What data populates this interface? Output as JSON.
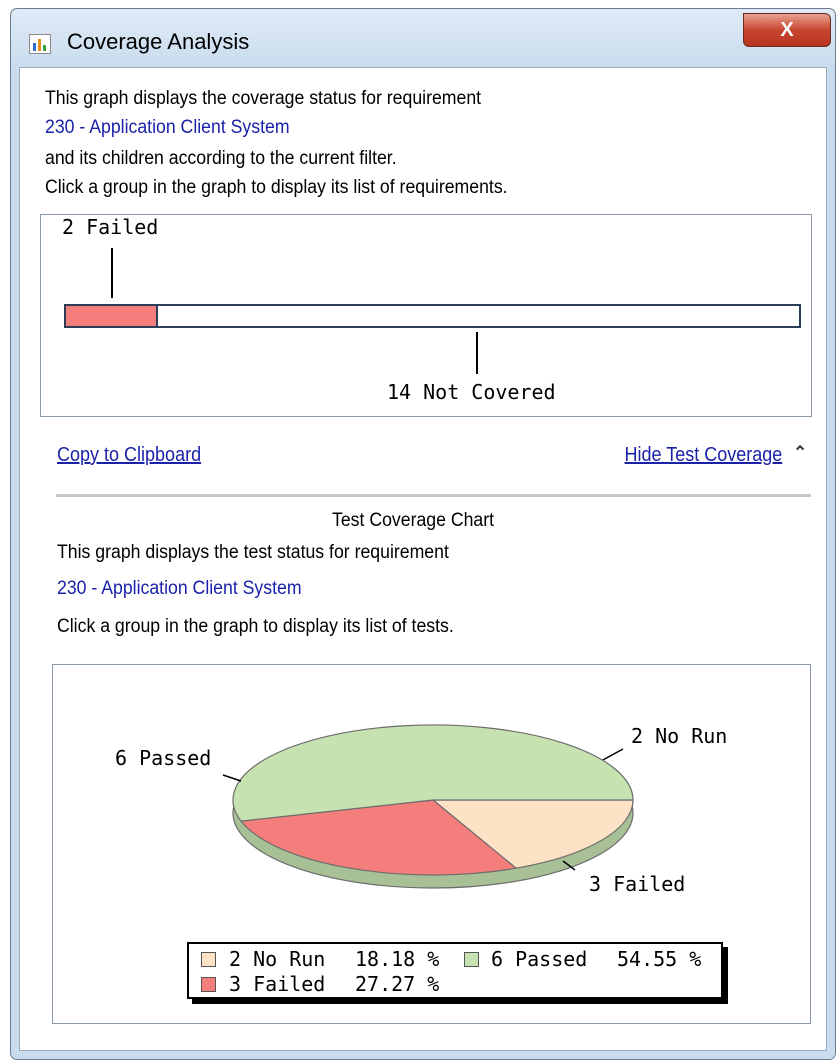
{
  "window": {
    "title": "Coverage Analysis",
    "close_glyph": "X"
  },
  "coverage": {
    "intro_line1": "This graph displays the coverage status for requirement",
    "requirement_link": "230 - Application Client System",
    "intro_line3": "and its children according to the current filter.",
    "intro_line4": "Click a group in the graph to display its list of requirements.",
    "bar": {
      "failed_label": "2 Failed",
      "not_covered_label": "14 Not Covered",
      "failed_count": 2,
      "not_covered_count": 14,
      "failed_color": "#f47e7b"
    }
  },
  "actions": {
    "copy_label": "Copy to Clipboard",
    "hide_label": "Hide Test Coverage",
    "hide_glyph": "≈"
  },
  "test_chart": {
    "heading": "Test Coverage Chart",
    "line1": "This graph displays the test status for requirement",
    "requirement_link": "230 - Application Client System",
    "line3": "Click a group in the graph to display its list of tests."
  },
  "chart_data": {
    "type": "pie",
    "slices": [
      {
        "label": "2 No Run",
        "count": 2,
        "percent": "18.18 %",
        "color": "#fde2c6"
      },
      {
        "label": "3 Failed",
        "count": 3,
        "percent": "27.27 %",
        "color": "#f47e7b"
      },
      {
        "label": "6 Passed",
        "count": 6,
        "percent": "54.55 %",
        "color": "#c6e2b0"
      }
    ],
    "legend": {
      "no_run": {
        "name": "2 No Run",
        "pct": "18.18 %"
      },
      "passed": {
        "name": "6 Passed",
        "pct": "54.55 %"
      },
      "failed": {
        "name": "3 Failed",
        "pct": "27.27 %"
      }
    }
  }
}
